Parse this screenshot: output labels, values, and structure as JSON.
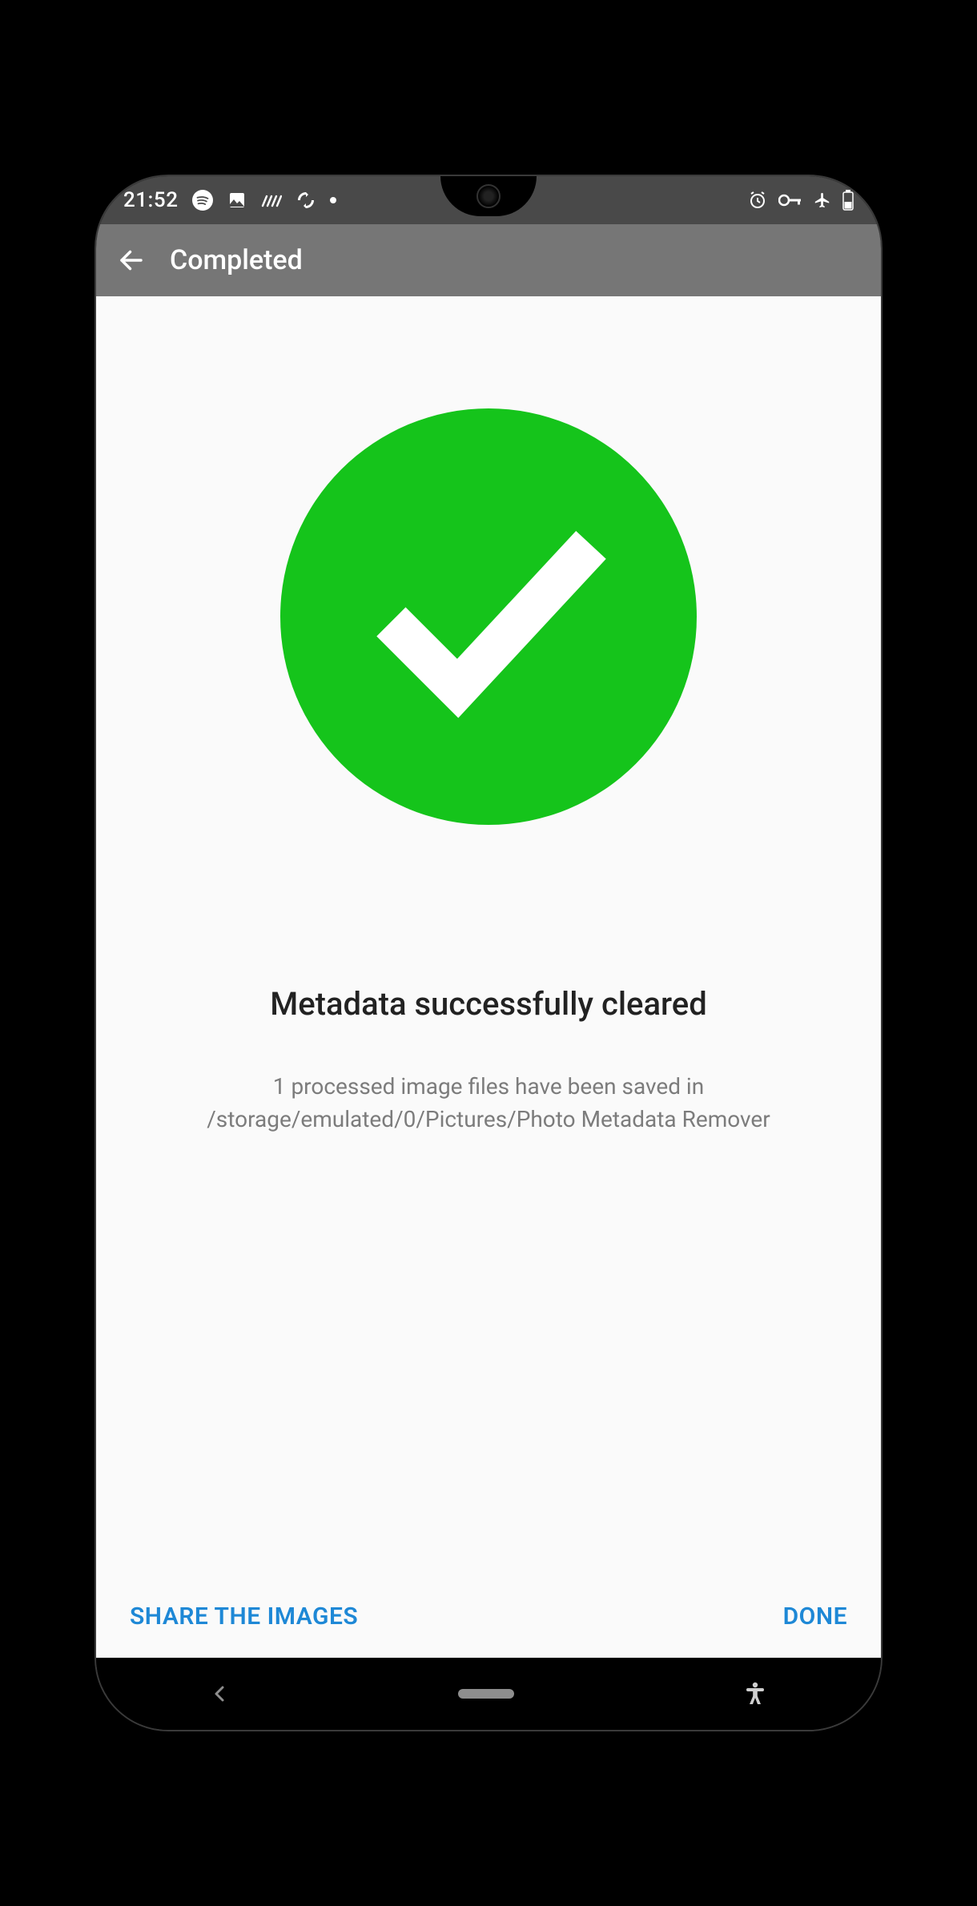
{
  "status": {
    "time": "21:52"
  },
  "actionbar": {
    "title": "Completed"
  },
  "content": {
    "headline": "Metadata successfully cleared",
    "subtext": "1 processed image files have been saved in /storage/emulated/0/Pictures/Photo Metadata Remover"
  },
  "buttons": {
    "share": "SHARE THE IMAGES",
    "done": "DONE"
  },
  "colors": {
    "success": "#15c41b",
    "accent": "#1e88d6"
  }
}
